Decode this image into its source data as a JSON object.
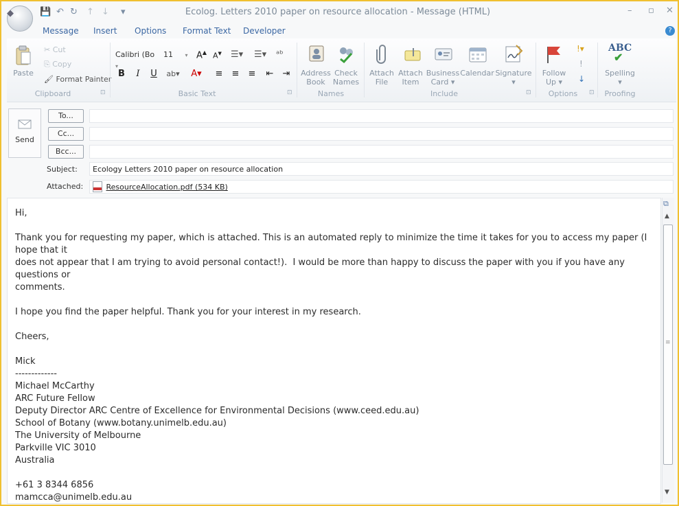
{
  "window": {
    "title": "Ecolog. Letters 2010 paper on resource allocation - Message (HTML)",
    "help_glyph": "?"
  },
  "qat": {
    "save": "💾",
    "undo": "↶",
    "redo": "↻",
    "up": "↑",
    "down": "↓",
    "more": "▾"
  },
  "tabs": [
    "Message",
    "Insert",
    "Options",
    "Format Text",
    "Developer"
  ],
  "ribbon": {
    "clipboard": {
      "paste": "Paste",
      "cut": "Cut",
      "copy": "Copy",
      "format_painter": "Format Painter",
      "group": "Clipboard"
    },
    "basic_text": {
      "font": "Calibri (Bo",
      "size": "11",
      "group": "Basic Text"
    },
    "names": {
      "address_book": [
        "Address",
        "Book"
      ],
      "check_names": [
        "Check",
        "Names"
      ],
      "group": "Names"
    },
    "include": {
      "attach_file": [
        "Attach",
        "File"
      ],
      "attach_item": [
        "Attach",
        "Item"
      ],
      "business_card": [
        "Business",
        "Card ▾"
      ],
      "calendar": "Calendar",
      "signature": [
        "Signature",
        "▾"
      ],
      "group": "Include"
    },
    "options": {
      "follow_up": [
        "Follow",
        "Up ▾"
      ],
      "group": "Options"
    },
    "proofing": {
      "spelling": "Spelling",
      "abc": "ABC",
      "group": "Proofing"
    }
  },
  "compose": {
    "send": "Send",
    "to": "To...",
    "cc": "Cc...",
    "bcc": "Bcc...",
    "subject_label": "Subject:",
    "subject": "Ecology Letters 2010 paper on resource allocation",
    "attached_label": "Attached:",
    "attachment": "ResourceAllocation.pdf (534 KB)"
  },
  "body": {
    "text": "Hi,\n\nThank you for requesting my paper, which is attached. This is an automated reply to minimize the time it takes for you to access my paper (I hope that it\ndoes not appear that I am trying to avoid personal contact!).  I would be more than happy to discuss the paper with you if you have any questions or\ncomments.\n\nI hope you find the paper helpful. Thank you for your interest in my research.\n\nCheers,\n\nMick\n-------------\nMichael McCarthy\nARC Future Fellow\nDeputy Director ARC Centre of Excellence for Environmental Decisions (www.ceed.edu.au)\nSchool of Botany (www.botany.unimelb.edu.au)\nThe University of Melbourne\nParkville VIC 3010\nAustralia\n\n+61 3 8344 6856\nmamcca@unimelb.edu.au\nhttp://mickresearch.wordpress.com\n@mickresearch"
  }
}
